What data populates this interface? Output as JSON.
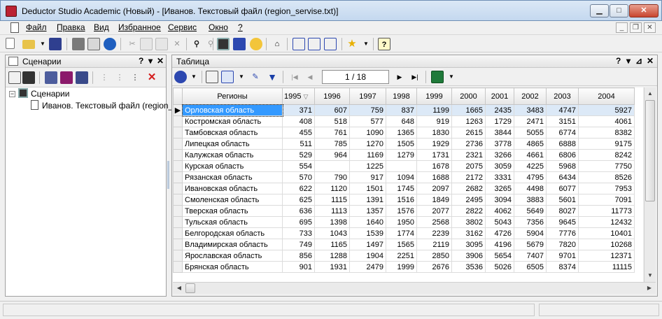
{
  "window": {
    "title": "Deductor Studio Academic (Новый) - [Иванов. Текстовый файл (region_servise.txt)]",
    "min_glyph": "▁",
    "max_glyph": "□",
    "close_glyph": "✕"
  },
  "menu": {
    "items": [
      "Файл",
      "Правка",
      "Вид",
      "Избранное",
      "Сервис",
      "Окно",
      "?"
    ],
    "mdi_min": "_",
    "mdi_restore": "❐",
    "mdi_close": "✕"
  },
  "left_panel": {
    "title": "Сценарии",
    "help_glyph": "?",
    "pin_glyph": "▾",
    "close_glyph": "✕",
    "tree": {
      "root_label": "Сценарии",
      "child_label": "Иванов. Текстовый файл (region_s",
      "expand_glyph": "−"
    }
  },
  "right_panel": {
    "title": "Таблица",
    "help_glyph": "?",
    "pin_glyph": "▾",
    "float_glyph": "⊿",
    "close_glyph": "✕",
    "pager": "1 / 18",
    "colors": {
      "selected_cell": "#3399ff",
      "selected_row": "#dce9f7"
    }
  },
  "table": {
    "columns": [
      "Регионы",
      "1995",
      "1996",
      "1997",
      "1998",
      "1999",
      "2000",
      "2001",
      "2002",
      "2003",
      "2004"
    ],
    "sorted_column_glyph": "▽",
    "row_indicator": "▶",
    "rows": [
      [
        "Орловская область",
        "371",
        "607",
        "759",
        "837",
        "1199",
        "1665",
        "2435",
        "3483",
        "4747",
        "5927"
      ],
      [
        "Костромская область",
        "408",
        "518",
        "577",
        "648",
        "919",
        "1263",
        "1729",
        "2471",
        "3151",
        "4061"
      ],
      [
        "Тамбовская область",
        "455",
        "761",
        "1090",
        "1365",
        "1830",
        "2615",
        "3844",
        "5055",
        "6774",
        "8382"
      ],
      [
        "Липецкая область",
        "511",
        "785",
        "1270",
        "1505",
        "1929",
        "2736",
        "3778",
        "4865",
        "6888",
        "9175"
      ],
      [
        "Калужская область",
        "529",
        "964",
        "1169",
        "1279",
        "1731",
        "2321",
        "3266",
        "4661",
        "6806",
        "8242"
      ],
      [
        "Курская область",
        "554",
        "",
        "1225",
        "",
        "1678",
        "2075",
        "3059",
        "4225",
        "5968",
        "7750"
      ],
      [
        "Рязанская область",
        "570",
        "790",
        "917",
        "1094",
        "1688",
        "2172",
        "3331",
        "4795",
        "6434",
        "8526"
      ],
      [
        "Ивановская область",
        "622",
        "1120",
        "1501",
        "1745",
        "2097",
        "2682",
        "3265",
        "4498",
        "6077",
        "7953"
      ],
      [
        "Смоленская область",
        "625",
        "1115",
        "1391",
        "1516",
        "1849",
        "2495",
        "3094",
        "3883",
        "5601",
        "7091"
      ],
      [
        "Тверская область",
        "636",
        "1113",
        "1357",
        "1576",
        "2077",
        "2822",
        "4062",
        "5649",
        "8027",
        "11773"
      ],
      [
        "Тульская область",
        "695",
        "1398",
        "1640",
        "1950",
        "2568",
        "3802",
        "5043",
        "7356",
        "9645",
        "12432"
      ],
      [
        "Белгородская область",
        "733",
        "1043",
        "1539",
        "1774",
        "2239",
        "3162",
        "4726",
        "5904",
        "7776",
        "10401"
      ],
      [
        "Владимирская область",
        "749",
        "1165",
        "1497",
        "1565",
        "2119",
        "3095",
        "4196",
        "5679",
        "7820",
        "10268"
      ],
      [
        "Ярославская область",
        "856",
        "1288",
        "1904",
        "2251",
        "2850",
        "3906",
        "5654",
        "7407",
        "9701",
        "12371"
      ],
      [
        "Брянская область",
        "901",
        "1931",
        "2479",
        "1999",
        "2676",
        "3536",
        "5026",
        "6505",
        "8374",
        "11115"
      ]
    ]
  }
}
